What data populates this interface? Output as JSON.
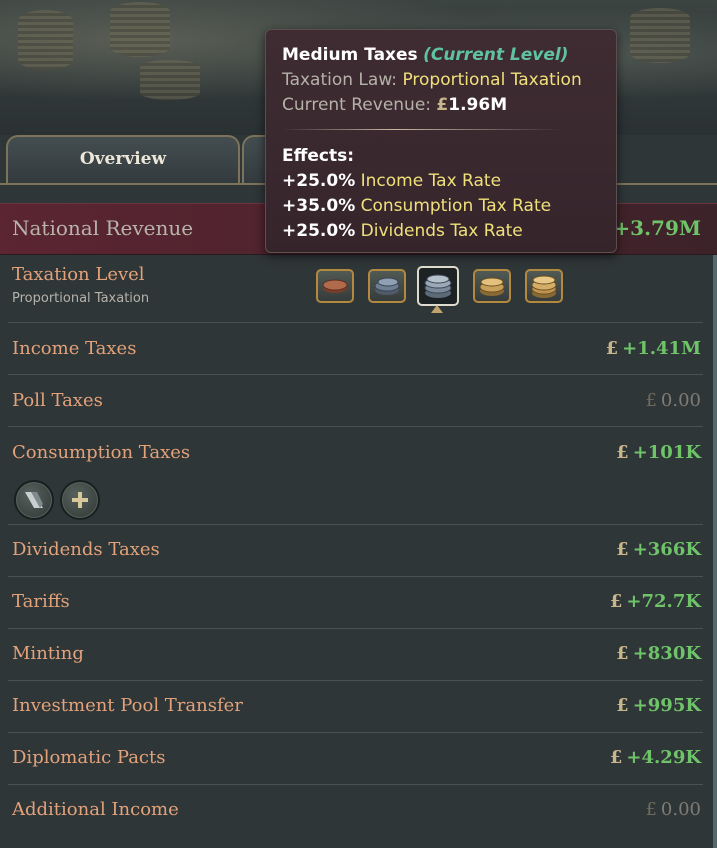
{
  "tabs": [
    {
      "label": "Overview"
    },
    {
      "label": ""
    }
  ],
  "national_revenue": {
    "label": "National Revenue",
    "value": "+3.79M"
  },
  "taxation": {
    "title": "Taxation Level",
    "law": "Proportional Taxation",
    "levels": [
      "Very Low Taxes",
      "Low Taxes",
      "Medium Taxes",
      "High Taxes",
      "Very High Taxes"
    ],
    "selected_index": 2
  },
  "currency_symbol": "£",
  "rows": [
    {
      "label": "Income Taxes",
      "value": "+1.41M"
    },
    {
      "label": "Poll Taxes",
      "value": "0.00"
    },
    {
      "label": "Consumption Taxes",
      "value": "+101K"
    },
    {
      "label": "Dividends Taxes",
      "value": "+366K"
    },
    {
      "label": "Tariffs",
      "value": "+72.7K"
    },
    {
      "label": "Minting",
      "value": "+830K"
    },
    {
      "label": "Investment Pool Transfer",
      "value": "+995K"
    },
    {
      "label": "Diplomatic Pacts",
      "value": "+4.29K"
    },
    {
      "label": "Additional Income",
      "value": "0.00"
    }
  ],
  "consumption_buttons": [
    "goods-icon",
    "plus-icon"
  ],
  "tooltip": {
    "title": "Medium Taxes",
    "current_tag": "(Current Level)",
    "law_label": "Taxation Law:",
    "law_value": "Proportional Taxation",
    "revenue_label": "Current Revenue:",
    "revenue_value": "1.96M",
    "effects_label": "Effects:",
    "effects": [
      {
        "value": "+25.0%",
        "name": "Income Tax Rate"
      },
      {
        "value": "+35.0%",
        "name": "Consumption Tax Rate"
      },
      {
        "value": "+25.0%",
        "name": "Dividends Tax Rate"
      }
    ]
  },
  "colors": {
    "label": "#e3a27a",
    "positive": "#6fc46a",
    "zero": "#7d7b74",
    "accent_gold": "#b2893d",
    "tooltip_highlight": "#f0e07a",
    "current_level": "#5fc3a1"
  }
}
